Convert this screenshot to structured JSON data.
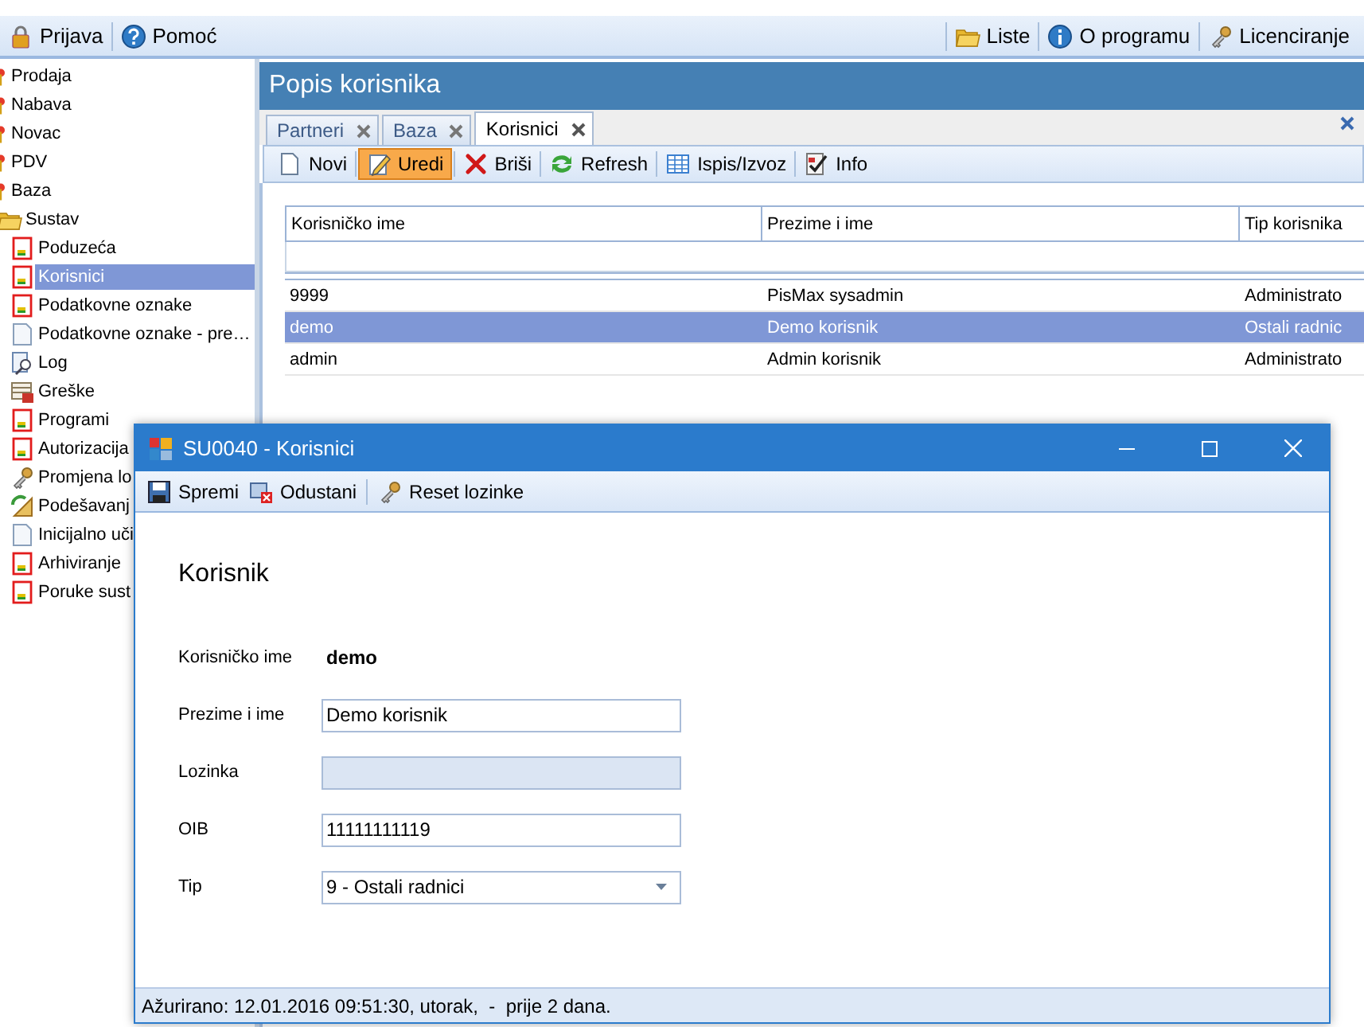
{
  "menu_bar": {
    "left": [
      {
        "label": "Prijava",
        "kind": "lock"
      },
      {
        "label": "Pomoć",
        "kind": "help"
      }
    ],
    "right": [
      {
        "label": "Liste",
        "kind": "folder"
      },
      {
        "label": "O programu",
        "kind": "about"
      },
      {
        "label": "Licenciranje",
        "kind": "keys"
      }
    ]
  },
  "sidebar": {
    "items": [
      {
        "label": "Prodaja",
        "kind": "pin",
        "selected": false
      },
      {
        "label": "Nabava",
        "kind": "pin",
        "selected": false
      },
      {
        "label": "Novac",
        "kind": "pin",
        "selected": false
      },
      {
        "label": "PDV",
        "kind": "pin",
        "selected": false
      },
      {
        "label": "Baza",
        "kind": "pin",
        "selected": false
      },
      {
        "label": "Sustav",
        "kind": "folder",
        "selected": false,
        "children": [
          {
            "label": "Poduzeća",
            "kind": "form",
            "selected": false
          },
          {
            "label": "Korisnici",
            "kind": "form",
            "selected": true
          },
          {
            "label": "Podatkovne oznake",
            "kind": "form",
            "selected": false
          },
          {
            "label": "Podatkovne oznake - pre…",
            "kind": "page",
            "selected": false
          },
          {
            "label": "Log",
            "kind": "log",
            "selected": false
          },
          {
            "label": "Greške",
            "kind": "errors",
            "selected": false
          },
          {
            "label": "Programi",
            "kind": "form",
            "selected": false
          },
          {
            "label": "Autorizacija",
            "kind": "form",
            "selected": false
          },
          {
            "label": "Promjena lo",
            "kind": "keys",
            "selected": false
          },
          {
            "label": "Podešavanj",
            "kind": "settings",
            "selected": false
          },
          {
            "label": "Inicijalno uči",
            "kind": "page",
            "selected": false
          },
          {
            "label": "Arhiviranje",
            "kind": "form",
            "selected": false
          },
          {
            "label": "Poruke sust",
            "kind": "form",
            "selected": false
          }
        ]
      }
    ]
  },
  "panel": {
    "title": "Popis korisnika",
    "tabs": [
      {
        "label": "Partneri",
        "selected": false
      },
      {
        "label": "Baza",
        "selected": false
      },
      {
        "label": "Korisnici",
        "selected": true
      }
    ],
    "toolbar": [
      {
        "label": "Novi",
        "kind": "new",
        "selected": false
      },
      {
        "label": "Uredi",
        "kind": "edit",
        "selected": true
      },
      {
        "label": "Briši",
        "kind": "delete",
        "selected": false
      },
      {
        "label": "Refresh",
        "kind": "refresh",
        "selected": false
      },
      {
        "label": "Ispis/Izvoz",
        "kind": "table",
        "selected": false
      },
      {
        "label": "Info",
        "kind": "info",
        "selected": false
      }
    ],
    "table": {
      "columns": [
        "Korisničko ime",
        "Prezime i ime",
        "Tip korisnika"
      ],
      "rows": [
        {
          "cells": [
            "9999",
            "PisMax sysadmin",
            "Administrato"
          ],
          "selected": false
        },
        {
          "cells": [
            "demo",
            "Demo korisnik",
            "Ostali radnic"
          ],
          "selected": true
        },
        {
          "cells": [
            "admin",
            "Admin korisnik",
            "Administrato"
          ],
          "selected": false
        }
      ]
    }
  },
  "dialog": {
    "title": "SU0040 - Korisnici",
    "toolbar": [
      {
        "label": "Spremi",
        "kind": "save"
      },
      {
        "label": "Odustani",
        "kind": "cancel"
      },
      {
        "label": "Reset lozinke",
        "kind": "keys"
      }
    ],
    "heading": "Korisnik",
    "fields": [
      {
        "label": "Korisničko ime",
        "kind": "readonly",
        "value": "demo"
      },
      {
        "label": "Prezime i ime",
        "kind": "text",
        "value": "Demo korisnik"
      },
      {
        "label": "Lozinka",
        "kind": "disabled"
      },
      {
        "label": "OIB",
        "kind": "text",
        "value": "11111111119"
      },
      {
        "label": "Tip",
        "kind": "select",
        "value": "9 - Ostali radnici"
      }
    ],
    "status_bar": "Ažurirano: 12.01.2016 09:51:30, utorak,  -  prije 2 dana."
  }
}
